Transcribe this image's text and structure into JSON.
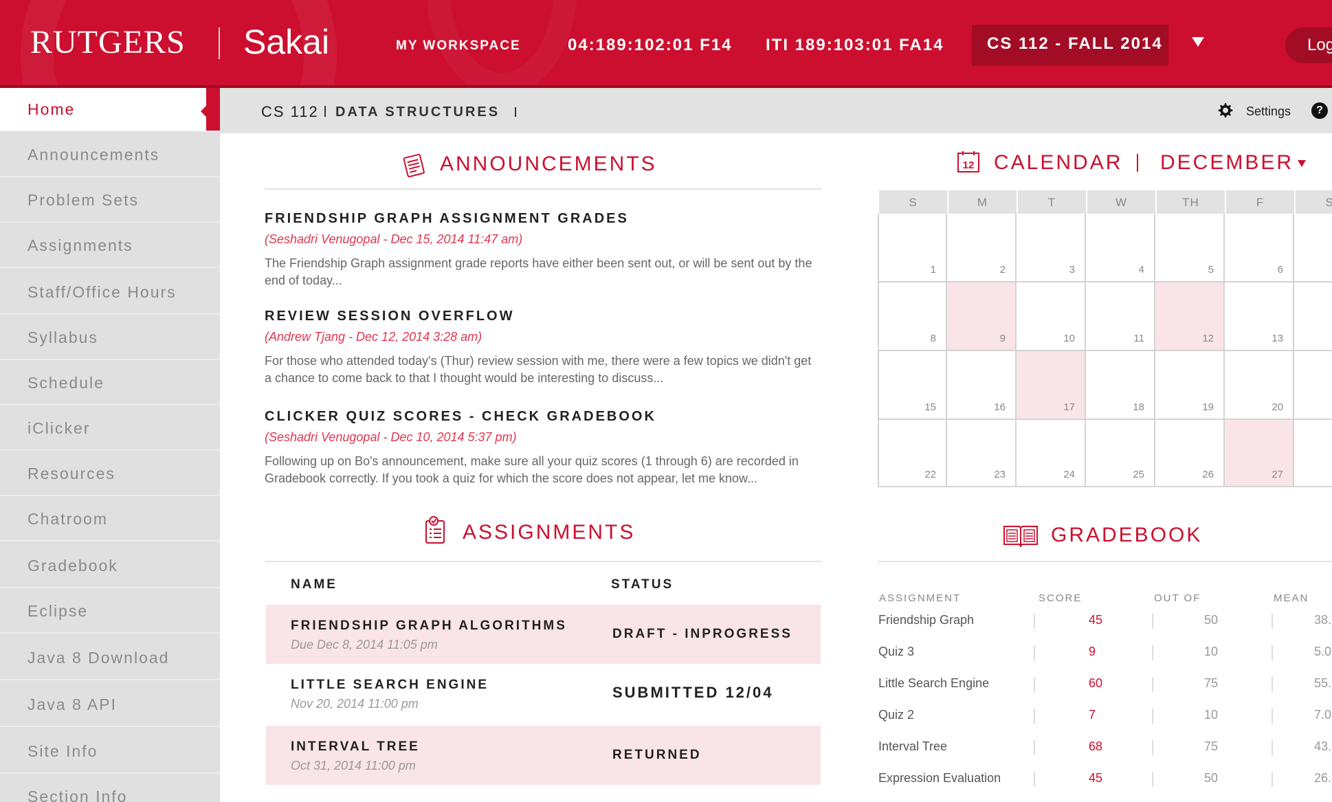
{
  "header": {
    "brand": "RUTGERS",
    "product": "Sakai",
    "nav": [
      "MY WORKSPACE",
      "04:189:102:01 F14",
      "ITI 189:103:01 FA14"
    ],
    "active_site": "CS 112 - FALL 2014",
    "logout_label": "Log"
  },
  "sidebar": {
    "items": [
      {
        "label": "Home"
      },
      {
        "label": "Announcements"
      },
      {
        "label": "Problem Sets"
      },
      {
        "label": "Assignments"
      },
      {
        "label": "Staff/Office Hours"
      },
      {
        "label": "Syllabus"
      },
      {
        "label": "Schedule"
      },
      {
        "label": "iClicker"
      },
      {
        "label": "Resources"
      },
      {
        "label": "Chatroom"
      },
      {
        "label": "Gradebook"
      },
      {
        "label": "Eclipse"
      },
      {
        "label": "Java 8 Download"
      },
      {
        "label": "Java 8 API"
      },
      {
        "label": "Site Info"
      },
      {
        "label": "Section Info"
      }
    ]
  },
  "subheader": {
    "course_code": "CS 112",
    "course_title": "DATA STRUCTURES",
    "settings_label": "Settings",
    "help_label": "?"
  },
  "announcements": {
    "heading": "ANNOUNCEMENTS",
    "items": [
      {
        "title": "FRIENDSHIP GRAPH ASSIGNMENT GRADES",
        "meta": "(Seshadri Venugopal - Dec 15, 2014 11:47 am)",
        "body": "The Friendship Graph assignment grade reports have either been sent out, or will be sent out by the end of today..."
      },
      {
        "title": "REVIEW SESSION OVERFLOW",
        "meta": "(Andrew Tjang - Dec 12, 2014 3:28 am)",
        "body": "For those who attended today's (Thur) review session with me, there were a few topics we didn't get a chance to come back to that I thought would be interesting to discuss..."
      },
      {
        "title": "CLICKER QUIZ SCORES - CHECK GRADEBOOK",
        "meta": "(Seshadri Venugopal - Dec 10, 2014 5:37 pm)",
        "body": "Following up on Bo's announcement, make sure all your quiz scores (1 through 6) are recorded in Gradebook correctly. If you took a quiz for which the score does not appear, let me know..."
      }
    ]
  },
  "assignments": {
    "heading": "ASSIGNMENTS",
    "col_name": "NAME",
    "col_status": "STATUS",
    "rows": [
      {
        "name": "FRIENDSHIP GRAPH ALGORITHMS",
        "due": "Due Dec 8, 2014 11:05 pm",
        "status": "DRAFT - INPROGRESS"
      },
      {
        "name": "LITTLE SEARCH ENGINE",
        "due": "Nov 20, 2014 11:00 pm",
        "status": "SUBMITTED 12/04"
      },
      {
        "name": "INTERVAL TREE",
        "due": "Oct 31, 2014 11:00 pm",
        "status": "RETURNED"
      }
    ]
  },
  "calendar": {
    "heading": "CALENDAR",
    "month": "DECEMBER",
    "icon_day": "12",
    "days_of_week": [
      "S",
      "M",
      "T",
      "W",
      "TH",
      "F",
      "S"
    ],
    "weeks": [
      [
        "1",
        "2",
        "3",
        "4",
        "5",
        "6"
      ],
      [
        "8",
        "9",
        "10",
        "11",
        "12",
        "13"
      ],
      [
        "15",
        "16",
        "17",
        "18",
        "19",
        "20"
      ],
      [
        "22",
        "23",
        "24",
        "25",
        "26",
        "27"
      ]
    ],
    "highlighted": [
      "9",
      "12",
      "17",
      "27"
    ],
    "accent": "#cc0f2f",
    "highlight_color": "#f9e4e7"
  },
  "gradebook": {
    "heading": "GRADEBOOK",
    "columns": [
      "ASSIGNMENT",
      "SCORE",
      "OUT OF",
      "MEAN"
    ],
    "rows": [
      {
        "name": "Friendship Graph",
        "score": "45",
        "out_of": "50",
        "mean": "38."
      },
      {
        "name": "Quiz 3",
        "score": "9",
        "out_of": "10",
        "mean": "5.0"
      },
      {
        "name": "Little Search Engine",
        "score": "60",
        "out_of": "75",
        "mean": "55."
      },
      {
        "name": "Quiz 2",
        "score": "7",
        "out_of": "10",
        "mean": "7.0"
      },
      {
        "name": "Interval Tree",
        "score": "68",
        "out_of": "75",
        "mean": "43."
      },
      {
        "name": "Expression Evaluation",
        "score": "45",
        "out_of": "50",
        "mean": "26."
      }
    ]
  },
  "icons": {
    "announcements": "notepad-icon",
    "assignments": "checklist-icon",
    "calendar": "calendar-icon",
    "gradebook": "open-book-icon",
    "settings": "gear-icon",
    "help": "help-icon",
    "dropdown": "caret-down-icon"
  }
}
